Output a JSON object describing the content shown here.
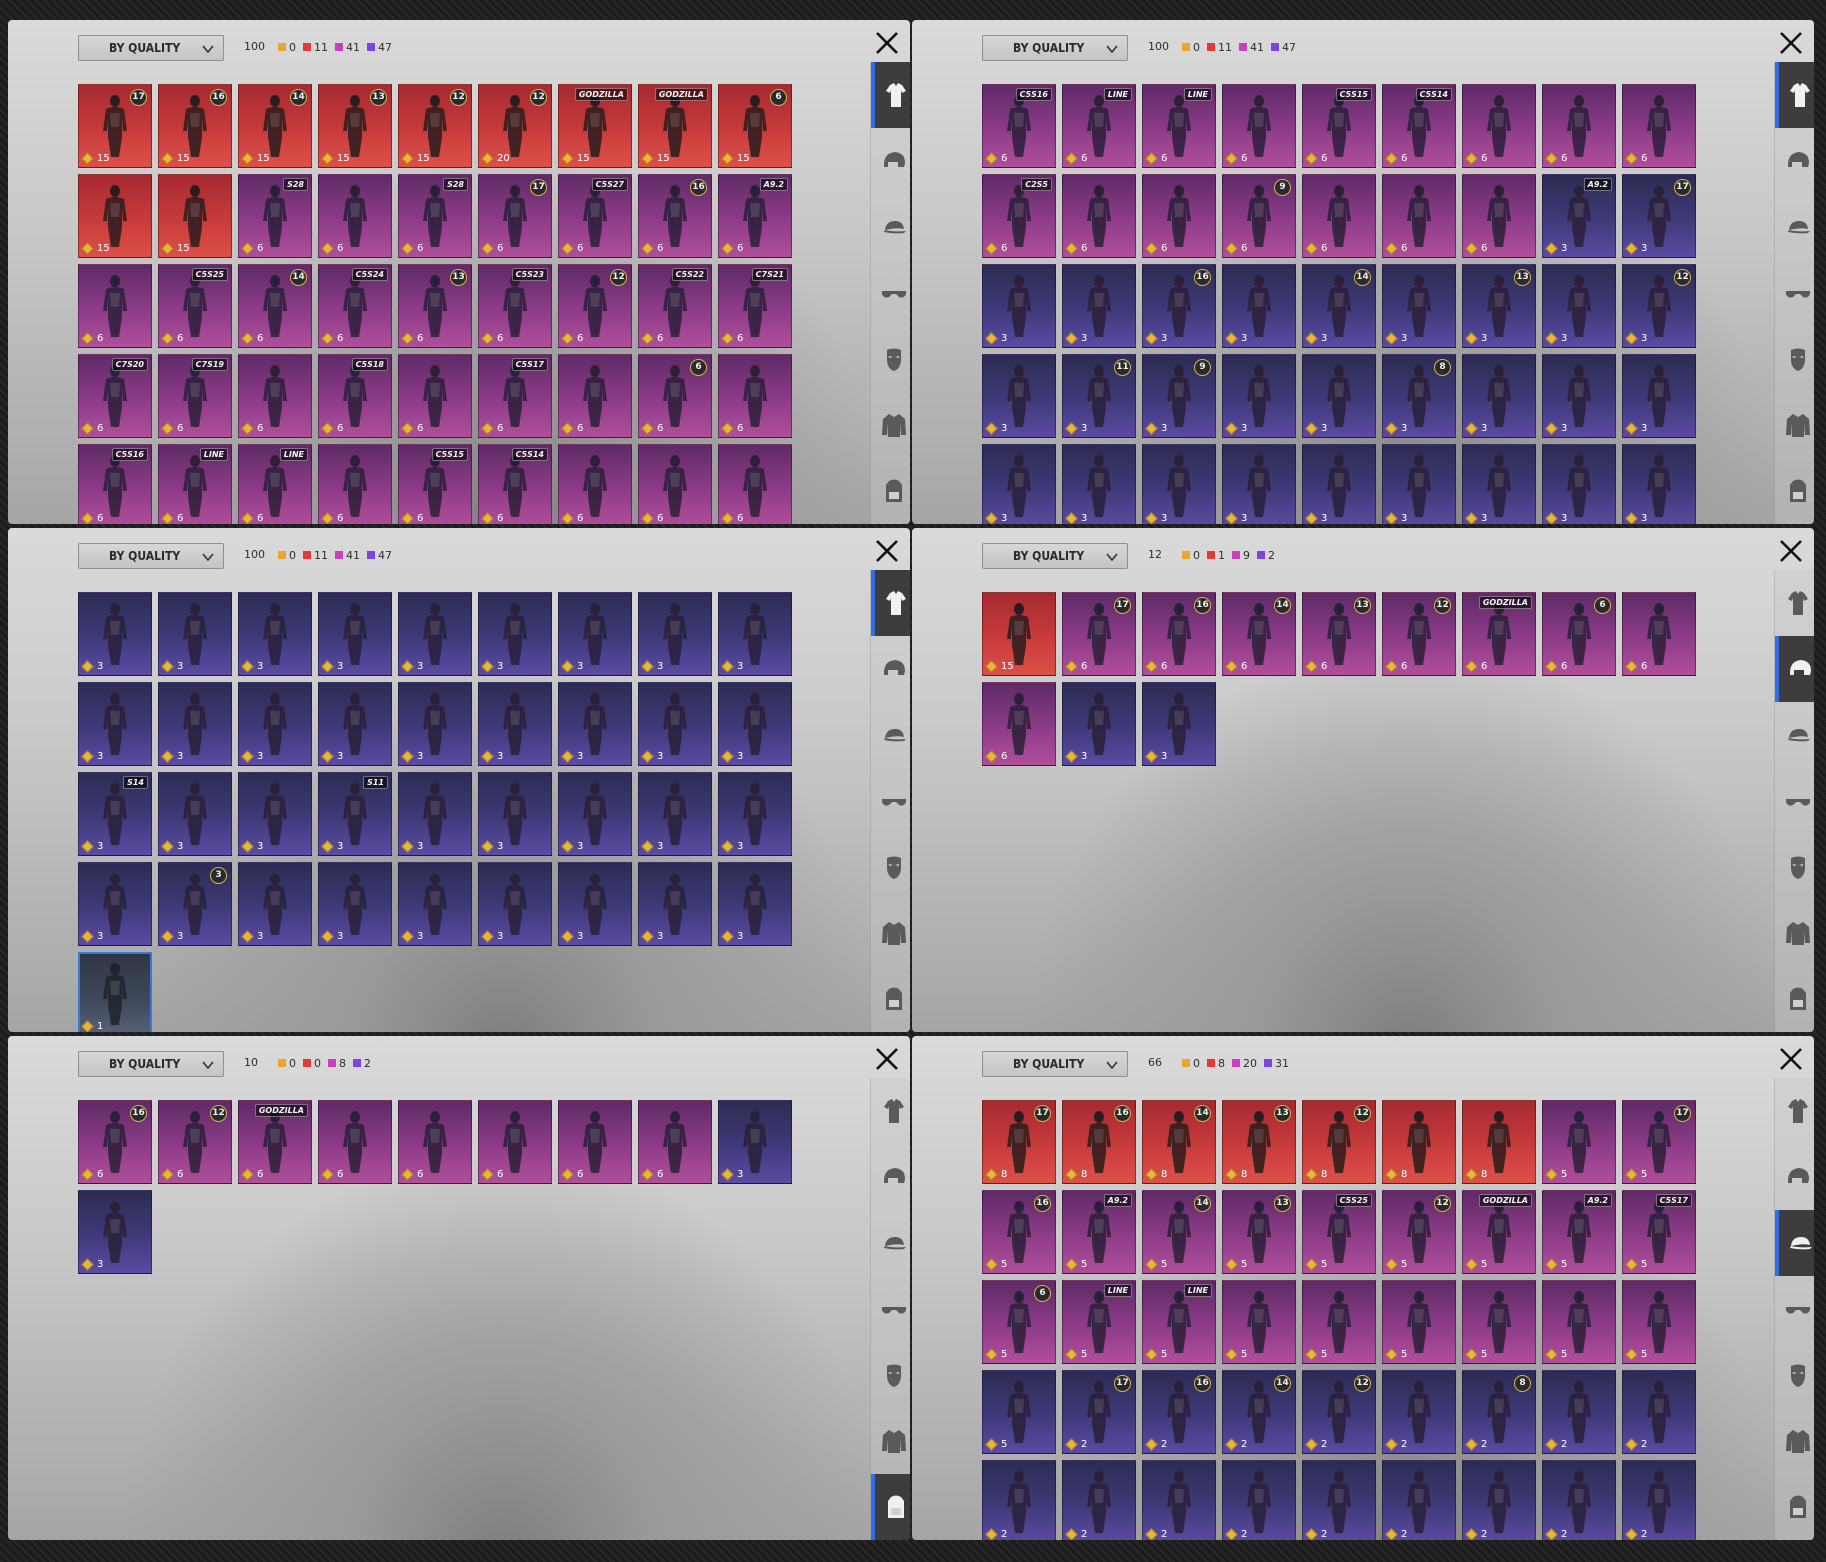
{
  "sort_label": "BY QUALITY",
  "panels": [
    {
      "total": "100",
      "counts": [
        "0",
        "11",
        "41",
        "47"
      ],
      "active_tab": 0,
      "items": [
        [
          "r",
          "17",
          "15"
        ],
        [
          "r",
          "16",
          "15"
        ],
        [
          "r",
          "14",
          "15"
        ],
        [
          "r",
          "13",
          "15"
        ],
        [
          "r",
          "12",
          "15"
        ],
        [
          "r",
          "12",
          "20"
        ],
        [
          "r",
          "GODZILLA",
          "15"
        ],
        [
          "r",
          "GODZILLA",
          "15"
        ],
        [
          "r",
          "6",
          "15"
        ],
        [
          "r",
          "",
          "15"
        ],
        [
          "r",
          "",
          "15"
        ],
        [
          "p",
          "S28",
          "6"
        ],
        [
          "p",
          "",
          "6"
        ],
        [
          "p",
          "S28",
          "6"
        ],
        [
          "p",
          "17",
          "6"
        ],
        [
          "p",
          "C5S27",
          "6"
        ],
        [
          "p",
          "16",
          "6"
        ],
        [
          "p",
          "A9.2",
          "6"
        ],
        [
          "p",
          "",
          "6"
        ],
        [
          "p",
          "C5S25",
          "6"
        ],
        [
          "p",
          "14",
          "6"
        ],
        [
          "p",
          "C5S24",
          "6"
        ],
        [
          "p",
          "13",
          "6"
        ],
        [
          "p",
          "C5S23",
          "6"
        ],
        [
          "p",
          "12",
          "6"
        ],
        [
          "p",
          "C5S22",
          "6"
        ],
        [
          "p",
          "C7S21",
          "6"
        ],
        [
          "p",
          "C7S20",
          "6"
        ],
        [
          "p",
          "C7S19",
          "6"
        ],
        [
          "p",
          "",
          "6"
        ],
        [
          "p",
          "C5S18",
          "6"
        ],
        [
          "p",
          "",
          "6"
        ],
        [
          "p",
          "C5S17",
          "6"
        ],
        [
          "p",
          "",
          "6"
        ],
        [
          "p",
          "6",
          "6"
        ],
        [
          "p",
          "",
          "6"
        ],
        [
          "p",
          "C5S16",
          "6"
        ],
        [
          "p",
          "LINE",
          "6"
        ],
        [
          "p",
          "LINE",
          "6"
        ],
        [
          "p",
          "",
          "6"
        ],
        [
          "p",
          "C5S15",
          "6"
        ],
        [
          "p",
          "C5S14",
          "6"
        ],
        [
          "p",
          "",
          "6"
        ],
        [
          "p",
          "",
          "6"
        ],
        [
          "p",
          "",
          "6"
        ]
      ]
    },
    {
      "total": "100",
      "counts": [
        "0",
        "11",
        "41",
        "47"
      ],
      "active_tab": 0,
      "items": [
        [
          "p",
          "C5S16",
          "6"
        ],
        [
          "p",
          "LINE",
          "6"
        ],
        [
          "p",
          "LINE",
          "6"
        ],
        [
          "p",
          "",
          "6"
        ],
        [
          "p",
          "C5S15",
          "6"
        ],
        [
          "p",
          "C5S14",
          "6"
        ],
        [
          "p",
          "",
          "6"
        ],
        [
          "p",
          "",
          "6"
        ],
        [
          "p",
          "",
          "6"
        ],
        [
          "p",
          "C2S5",
          "6"
        ],
        [
          "p",
          "",
          "6"
        ],
        [
          "p",
          "",
          "6"
        ],
        [
          "p",
          "9",
          "6"
        ],
        [
          "p",
          "",
          "6"
        ],
        [
          "p",
          "",
          "6"
        ],
        [
          "p",
          "",
          "6"
        ],
        [
          "b",
          "A9.2",
          "3"
        ],
        [
          "b",
          "17",
          "3"
        ],
        [
          "b",
          "",
          "3"
        ],
        [
          "b",
          "",
          "3"
        ],
        [
          "b",
          "16",
          "3"
        ],
        [
          "b",
          "",
          "3"
        ],
        [
          "b",
          "14",
          "3"
        ],
        [
          "b",
          "",
          "3"
        ],
        [
          "b",
          "13",
          "3"
        ],
        [
          "b",
          "",
          "3"
        ],
        [
          "b",
          "12",
          "3"
        ],
        [
          "b",
          "",
          "3"
        ],
        [
          "b",
          "11",
          "3"
        ],
        [
          "b",
          "9",
          "3"
        ],
        [
          "b",
          "",
          "3"
        ],
        [
          "b",
          "",
          "3"
        ],
        [
          "b",
          "8",
          "3"
        ],
        [
          "b",
          "",
          "3"
        ],
        [
          "b",
          "",
          "3"
        ],
        [
          "b",
          "",
          "3"
        ],
        [
          "b",
          "",
          "3"
        ],
        [
          "b",
          "",
          "3"
        ],
        [
          "b",
          "",
          "3"
        ],
        [
          "b",
          "",
          "3"
        ],
        [
          "b",
          "",
          "3"
        ],
        [
          "b",
          "",
          "3"
        ],
        [
          "b",
          "",
          "3"
        ],
        [
          "b",
          "",
          "3"
        ],
        [
          "b",
          "",
          "3"
        ]
      ]
    },
    {
      "total": "100",
      "counts": [
        "0",
        "11",
        "41",
        "47"
      ],
      "active_tab": 0,
      "items": [
        [
          "b",
          "",
          "3"
        ],
        [
          "b",
          "",
          "3"
        ],
        [
          "b",
          "",
          "3"
        ],
        [
          "b",
          "",
          "3"
        ],
        [
          "b",
          "",
          "3"
        ],
        [
          "b",
          "",
          "3"
        ],
        [
          "b",
          "",
          "3"
        ],
        [
          "b",
          "",
          "3"
        ],
        [
          "b",
          "",
          "3"
        ],
        [
          "b",
          "",
          "3"
        ],
        [
          "b",
          "",
          "3"
        ],
        [
          "b",
          "",
          "3"
        ],
        [
          "b",
          "",
          "3"
        ],
        [
          "b",
          "",
          "3"
        ],
        [
          "b",
          "",
          "3"
        ],
        [
          "b",
          "",
          "3"
        ],
        [
          "b",
          "",
          "3"
        ],
        [
          "b",
          "",
          "3"
        ],
        [
          "b",
          "S14",
          "3"
        ],
        [
          "b",
          "",
          "3"
        ],
        [
          "b",
          "",
          "3"
        ],
        [
          "b",
          "S11",
          "3"
        ],
        [
          "b",
          "",
          "3"
        ],
        [
          "b",
          "",
          "3"
        ],
        [
          "b",
          "",
          "3"
        ],
        [
          "b",
          "",
          "3"
        ],
        [
          "b",
          "",
          "3"
        ],
        [
          "b",
          "",
          "3"
        ],
        [
          "b",
          "3",
          "3"
        ],
        [
          "b",
          "",
          "3"
        ],
        [
          "b",
          "",
          "3"
        ],
        [
          "b",
          "",
          "3"
        ],
        [
          "b",
          "",
          "3"
        ],
        [
          "b",
          "",
          "3"
        ],
        [
          "b",
          "",
          "3"
        ],
        [
          "b",
          "",
          "3"
        ],
        [
          "g",
          "",
          "1"
        ]
      ]
    },
    {
      "total": "12",
      "counts": [
        "0",
        "1",
        "9",
        "2"
      ],
      "active_tab": 1,
      "items": [
        [
          "r",
          "",
          "15"
        ],
        [
          "p",
          "17",
          "6"
        ],
        [
          "p",
          "16",
          "6"
        ],
        [
          "p",
          "14",
          "6"
        ],
        [
          "p",
          "13",
          "6"
        ],
        [
          "p",
          "12",
          "6"
        ],
        [
          "p",
          "GODZILLA",
          "6"
        ],
        [
          "p",
          "6",
          "6"
        ],
        [
          "p",
          "",
          "6"
        ],
        [
          "p",
          "",
          "6"
        ],
        [
          "b",
          "",
          "3"
        ],
        [
          "b",
          "",
          "3"
        ]
      ]
    },
    {
      "total": "10",
      "counts": [
        "0",
        "0",
        "8",
        "2"
      ],
      "active_tab": 6,
      "items": [
        [
          "p",
          "16",
          "6"
        ],
        [
          "p",
          "12",
          "6"
        ],
        [
          "p",
          "GODZILLA",
          "6"
        ],
        [
          "p",
          "",
          "6"
        ],
        [
          "p",
          "",
          "6"
        ],
        [
          "p",
          "",
          "6"
        ],
        [
          "p",
          "",
          "6"
        ],
        [
          "p",
          "",
          "6"
        ],
        [
          "b",
          "",
          "3"
        ],
        [
          "b",
          "",
          "3"
        ]
      ]
    },
    {
      "total": "66",
      "counts": [
        "0",
        "8",
        "20",
        "31"
      ],
      "active_tab": 2,
      "items": [
        [
          "r",
          "17",
          "8"
        ],
        [
          "r",
          "16",
          "8"
        ],
        [
          "r",
          "14",
          "8"
        ],
        [
          "r",
          "13",
          "8"
        ],
        [
          "r",
          "12",
          "8"
        ],
        [
          "r",
          "",
          "8"
        ],
        [
          "r",
          "",
          "8"
        ],
        [
          "p",
          "",
          "5"
        ],
        [
          "p",
          "17",
          "5"
        ],
        [
          "p",
          "16",
          "5"
        ],
        [
          "p",
          "A9.2",
          "5"
        ],
        [
          "p",
          "14",
          "5"
        ],
        [
          "p",
          "13",
          "5"
        ],
        [
          "p",
          "C5S25",
          "5"
        ],
        [
          "p",
          "12",
          "5"
        ],
        [
          "p",
          "GODZILLA",
          "5"
        ],
        [
          "p",
          "A9.2",
          "5"
        ],
        [
          "p",
          "C5S17",
          "5"
        ],
        [
          "p",
          "6",
          "5"
        ],
        [
          "p",
          "LINE",
          "5"
        ],
        [
          "p",
          "LINE",
          "5"
        ],
        [
          "p",
          "",
          "5"
        ],
        [
          "p",
          "",
          "5"
        ],
        [
          "p",
          "",
          "5"
        ],
        [
          "p",
          "",
          "5"
        ],
        [
          "p",
          "",
          "5"
        ],
        [
          "p",
          "",
          "5"
        ],
        [
          "b",
          "",
          "5"
        ],
        [
          "b",
          "17",
          "2"
        ],
        [
          "b",
          "16",
          "2"
        ],
        [
          "b",
          "14",
          "2"
        ],
        [
          "b",
          "12",
          "2"
        ],
        [
          "b",
          "",
          "2"
        ],
        [
          "b",
          "8",
          "2"
        ],
        [
          "b",
          "",
          "2"
        ],
        [
          "b",
          "",
          "2"
        ],
        [
          "b",
          "",
          "2"
        ],
        [
          "b",
          "",
          "2"
        ],
        [
          "b",
          "",
          "2"
        ],
        [
          "b",
          "",
          "2"
        ],
        [
          "b",
          "",
          "2"
        ],
        [
          "b",
          "",
          "2"
        ],
        [
          "b",
          "",
          "2"
        ],
        [
          "b",
          "",
          "2"
        ],
        [
          "b",
          "",
          "2"
        ]
      ]
    }
  ],
  "tab_icons": [
    "outfit-icon",
    "helmet-icon",
    "cap-icon",
    "eyewear-icon",
    "mask-icon",
    "jacket-icon",
    "backpack-icon"
  ],
  "quality_colors": {
    "legendary": "#e8a530",
    "red": "#e03a3a",
    "purple": "#c93fc0",
    "blue": "#7b45e0"
  },
  "accent": "#2f6fe0"
}
